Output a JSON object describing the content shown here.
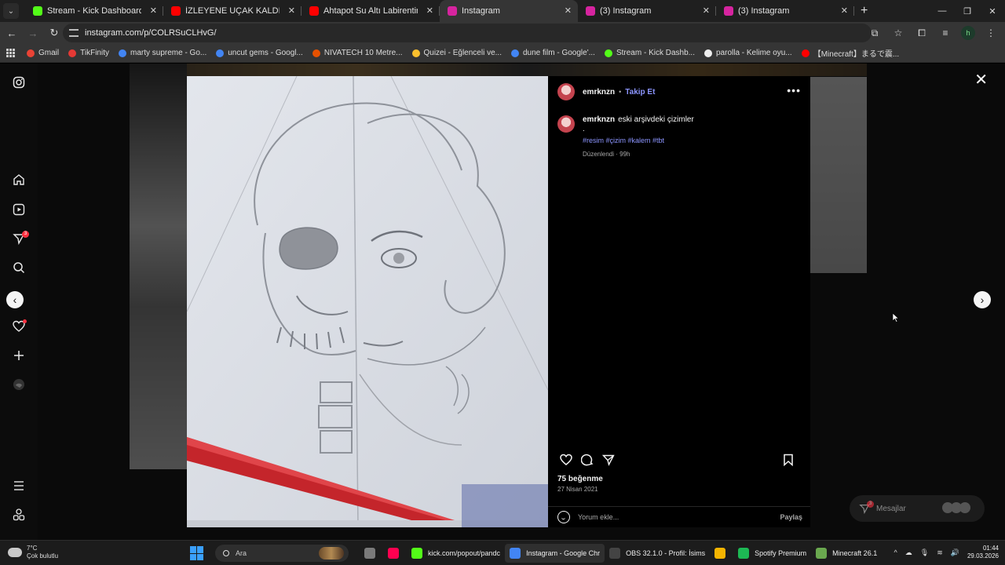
{
  "browser": {
    "tabs": [
      {
        "title": "Stream - Kick Dashboard",
        "favicon_color": "#53fc18",
        "active": false
      },
      {
        "title": "İZLEYENE UÇAK KALDIRMAYI Ö",
        "favicon_color": "#ff0000",
        "active": false
      },
      {
        "title": "Ahtapot Su Altı Labirentine Kar",
        "favicon_color": "#ff0000",
        "active": false
      },
      {
        "title": "Instagram",
        "favicon_color": "#d6249f",
        "active": true
      },
      {
        "title": "(3) Instagram",
        "favicon_color": "#d6249f",
        "active": false
      },
      {
        "title": "(3) Instagram",
        "favicon_color": "#d6249f",
        "active": false
      }
    ],
    "url": "instagram.com/p/COLRSuCLHvG/",
    "profile_initial": "h",
    "bookmarks": [
      {
        "label": "Gmail",
        "color": "#ea4335"
      },
      {
        "label": "TikFinity",
        "color": "#e53935"
      },
      {
        "label": "marty supreme - Go...",
        "color": "#4285f4"
      },
      {
        "label": "uncut gems - Googl...",
        "color": "#4285f4"
      },
      {
        "label": "NIVATECH 10 Metre...",
        "color": "#e65100"
      },
      {
        "label": "Quizei - Eğlenceli ve...",
        "color": "#fbc02d"
      },
      {
        "label": "dune film - Google'...",
        "color": "#4285f4"
      },
      {
        "label": "Stream - Kick Dashb...",
        "color": "#53fc18"
      },
      {
        "label": "parolla - Kelime oyu...",
        "color": "#eeeeee"
      },
      {
        "label": "【Minecraft】まるで震...",
        "color": "#ff0000"
      }
    ]
  },
  "nav_icons": [
    "instagram-icon",
    "home-icon",
    "reels-icon",
    "messages-icon",
    "search-icon",
    "notifications-icon",
    "create-icon",
    "profile-icon",
    "menu-icon",
    "apps-icon"
  ],
  "post": {
    "username": "emrknzn",
    "follow_label": "Takip Et",
    "more_label": "•••",
    "caption": "eski arşivdeki çizimler",
    "caption_dot": ".",
    "hashtags": "#resim #çizim #kalem #tbt",
    "edited": "Düzenlendi · 99h",
    "likes": "75 beğenme",
    "date": "27 Nisan 2021",
    "comment_placeholder": "Yorum ekle...",
    "share_label": "Paylaş"
  },
  "messages": {
    "label": "Mesajlar",
    "badge": "3"
  },
  "notification_badge": "3",
  "taskbar": {
    "weather_temp": "7°C",
    "weather_text": "Çok bulutlu",
    "search_placeholder": "Ara",
    "apps": [
      {
        "label": "",
        "color": "#7a7a7a",
        "active": false
      },
      {
        "label": "",
        "color": "#ff0050",
        "active": false
      },
      {
        "label": "kick.com/popout/pandc",
        "color": "#53fc18",
        "active": false
      },
      {
        "label": "Instagram - Google Chr",
        "color": "#4285f4",
        "active": true
      },
      {
        "label": "OBS 32.1.0 - Profil: İsims",
        "color": "#444444",
        "active": false
      },
      {
        "label": "",
        "color": "#f4b400",
        "active": false
      },
      {
        "label": "Spotify Premium",
        "color": "#1db954",
        "active": false
      },
      {
        "label": "Minecraft 26.1",
        "color": "#6aa84f",
        "active": false
      }
    ],
    "time": "01:44",
    "date": "29.03.2026"
  }
}
